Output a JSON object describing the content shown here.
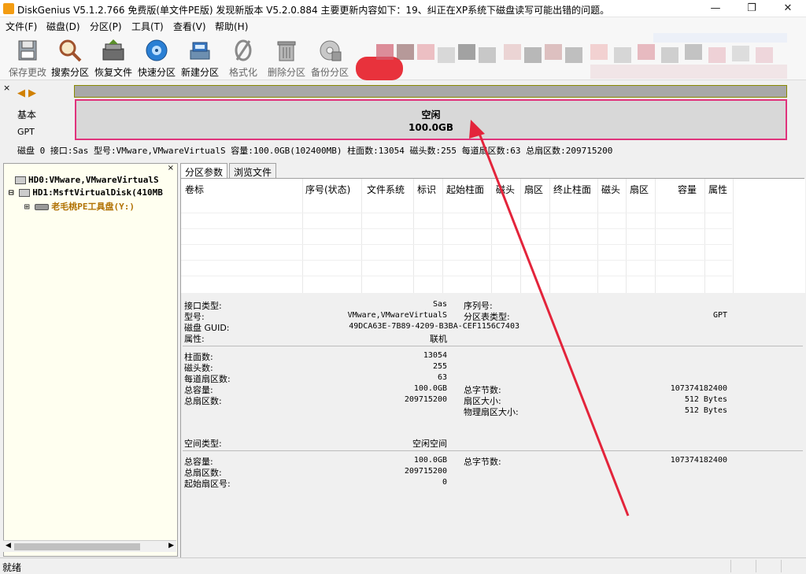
{
  "window": {
    "title": "DiskGenius V5.1.2.766 免费版(单文件PE版)   发现新版本 V5.2.0.884 主要更新内容如下：19、纠正在XP系统下磁盘读写可能出错的问题。",
    "minimize": "—",
    "maximize": "❐",
    "close": "✕"
  },
  "menu": [
    "文件(F)",
    "磁盘(D)",
    "分区(P)",
    "工具(T)",
    "查看(V)",
    "帮助(H)"
  ],
  "toolbar": [
    {
      "label": "保存更改",
      "icon": "save-icon"
    },
    {
      "label": "搜索分区",
      "icon": "magnifier-icon"
    },
    {
      "label": "恢复文件",
      "icon": "recover-icon"
    },
    {
      "label": "快速分区",
      "icon": "quick-partition-icon"
    },
    {
      "label": "新建分区",
      "icon": "new-partition-icon"
    },
    {
      "label": "格式化",
      "icon": "format-icon"
    },
    {
      "label": "删除分区",
      "icon": "trash-icon"
    },
    {
      "label": "备份分区",
      "icon": "backup-icon"
    }
  ],
  "diskmap": {
    "close": "×",
    "prev": "◀",
    "next": "▶",
    "style": "基本",
    "table": "GPT",
    "free_label": "空闲",
    "free_size": "100.0GB",
    "info": "磁盘 0 接口:Sas  型号:VMware,VMwareVirtualS  容量:100.0GB(102400MB)  柱面数:13054  磁头数:255  每道扇区数:63  总扇区数:209715200"
  },
  "tree": {
    "close": "×",
    "nodes": [
      {
        "label": "HD0:VMware,VMwareVirtualS",
        "expander": "",
        "level": 0
      },
      {
        "label": "HD1:MsftVirtualDisk(410MB",
        "expander": "⊟",
        "level": 0
      },
      {
        "label": "老毛桃PE工具盘(Y:)",
        "expander": "⊞",
        "level": 1
      }
    ],
    "scroll_left": "◀",
    "scroll_right": "▶"
  },
  "tabs": [
    "分区参数",
    "浏览文件"
  ],
  "columns": [
    "卷标",
    "序号(状态)",
    "文件系统",
    "标识",
    "起始柱面",
    "磁头",
    "扇区",
    "终止柱面",
    "磁头",
    "扇区",
    "容量",
    "属性"
  ],
  "details": {
    "iface_label": "接口类型:",
    "iface_value": "Sas",
    "serial_label": "序列号:",
    "model_label": "型号:",
    "model_value": "VMware,VMwareVirtualS",
    "pttype_label": "分区表类型:",
    "pttype_value": "GPT",
    "guid_label": "磁盘 GUID:",
    "guid_value": "49DCA63E-7B89-4209-B3BA-CEF1156C7403",
    "attr_label": "属性:",
    "attr_value": "联机",
    "cyl_label": "柱面数:",
    "cyl_value": "13054",
    "heads_label": "磁头数:",
    "heads_value": "255",
    "spt_label": "每道扇区数:",
    "spt_value": "63",
    "cap_label": "总容量:",
    "cap_value": "100.0GB",
    "bytes_label": "总字节数:",
    "bytes_value": "107374182400",
    "sectors_label": "总扇区数:",
    "sectors_value": "209715200",
    "secsize_label": "扇区大小:",
    "secsize_value": "512 Bytes",
    "physsec_label": "物理扇区大小:",
    "physsec_value": "512 Bytes",
    "space_label": "空间类型:",
    "space_value": "空闲空间",
    "cap2_label": "总容量:",
    "cap2_value": "100.0GB",
    "bytes2_label": "总字节数:",
    "bytes2_value": "107374182400",
    "sectors2_label": "总扇区数:",
    "sectors2_value": "209715200",
    "start_label": "起始扇区号:",
    "start_value": "0"
  },
  "status": "就绪",
  "colors": {
    "accent": "#e0337c",
    "arrow": "#e3243b"
  }
}
